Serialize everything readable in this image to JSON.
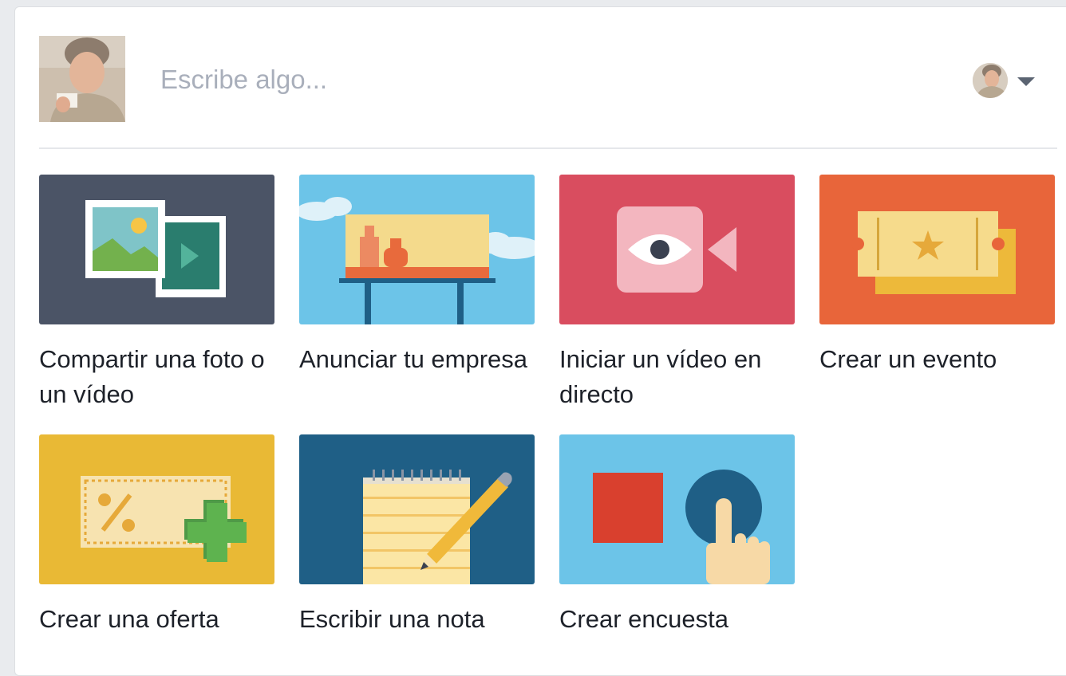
{
  "composer": {
    "placeholder": "Escribe algo..."
  },
  "actions": [
    {
      "label": "Compartir una foto o un vídeo",
      "icon": "photo-video-icon",
      "color": "#4b5466"
    },
    {
      "label": "Anunciar tu empresa",
      "icon": "billboard-icon",
      "color": "#6cc4e8"
    },
    {
      "label": "Iniciar un vídeo en directo",
      "icon": "live-video-icon",
      "color": "#d94d5f"
    },
    {
      "label": "Crear un evento",
      "icon": "ticket-icon",
      "color": "#e8653a"
    },
    {
      "label": "Crear una oferta",
      "icon": "offer-coupon-icon",
      "color": "#e9b935"
    },
    {
      "label": "Escribir una nota",
      "icon": "notepad-pencil-icon",
      "color": "#1f5f86"
    },
    {
      "label": "Crear encuesta",
      "icon": "poll-icon",
      "color": "#6cc4e8"
    }
  ]
}
